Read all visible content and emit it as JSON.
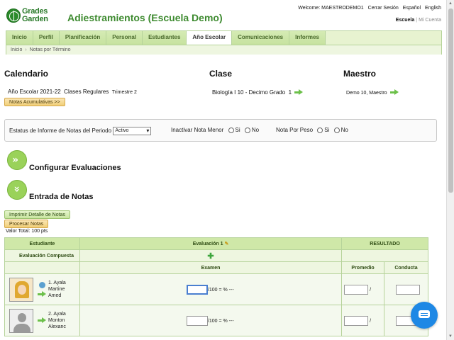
{
  "header": {
    "logo_text_line1": "Grades",
    "logo_text_line2": "Garden",
    "title": "Adiestramientos (Escuela Demo)",
    "welcome": "Welcome: MAESTRODEMO1",
    "logout": "Cerrar Sesión",
    "lang_es": "Español",
    "lang_en": "English",
    "account_school": "Escuela",
    "account_mine": "Mi Cuenta"
  },
  "nav": {
    "tabs": [
      "Inicio",
      "Perfil",
      "Planificación",
      "Personal",
      "Estudiantes",
      "Año Escolar",
      "Comunicaciones",
      "Informes"
    ],
    "selected_tab": "Año Escolar",
    "breadcrumb": [
      "Inicio",
      "Notas por Término"
    ]
  },
  "calendar": {
    "heading": "Calendario",
    "year": "Año Escolar 2021-22",
    "classes": "Clases Regulares",
    "term": "Trimestre 2",
    "cumulative_button": "Notas Acumulativas >>"
  },
  "class": {
    "heading": "Clase",
    "name": "Biología I 10 -  Decimo Grado",
    "section": "1"
  },
  "teacher": {
    "heading": "Maestro",
    "name": "Demo 10, Maestro"
  },
  "settings": {
    "status_label": "Estatus de Informe de Notas del Periodo",
    "status_value": "Activo",
    "inactivate_label": "Inactivar Nota Menor",
    "weight_label": "Nota Por Peso",
    "yes": "Si",
    "no": "No"
  },
  "sections": {
    "configure": "Configurar Evaluaciones",
    "entry": "Entrada de Notas"
  },
  "actions": {
    "print_detail": "Imprimir Detalle de Notas",
    "process": "Procesar Notas",
    "total_value": "Valor Total:  100 pts"
  },
  "table": {
    "col_student": "Estudiante",
    "col_eval": "Evaluación 1",
    "col_result": "RESULTADO",
    "composite": "Evaluación Compuesta",
    "exam": "Examen",
    "average": "Promedio",
    "conduct": "Conducta",
    "score_suffix": "/100 = % ---",
    "slash": "/",
    "students": [
      {
        "line1": "1. Ayala",
        "line2": "Martine",
        "line3": "Amed"
      },
      {
        "line1": "2. Ayala",
        "line2": "Monton",
        "line3": "Alexanc"
      }
    ]
  }
}
